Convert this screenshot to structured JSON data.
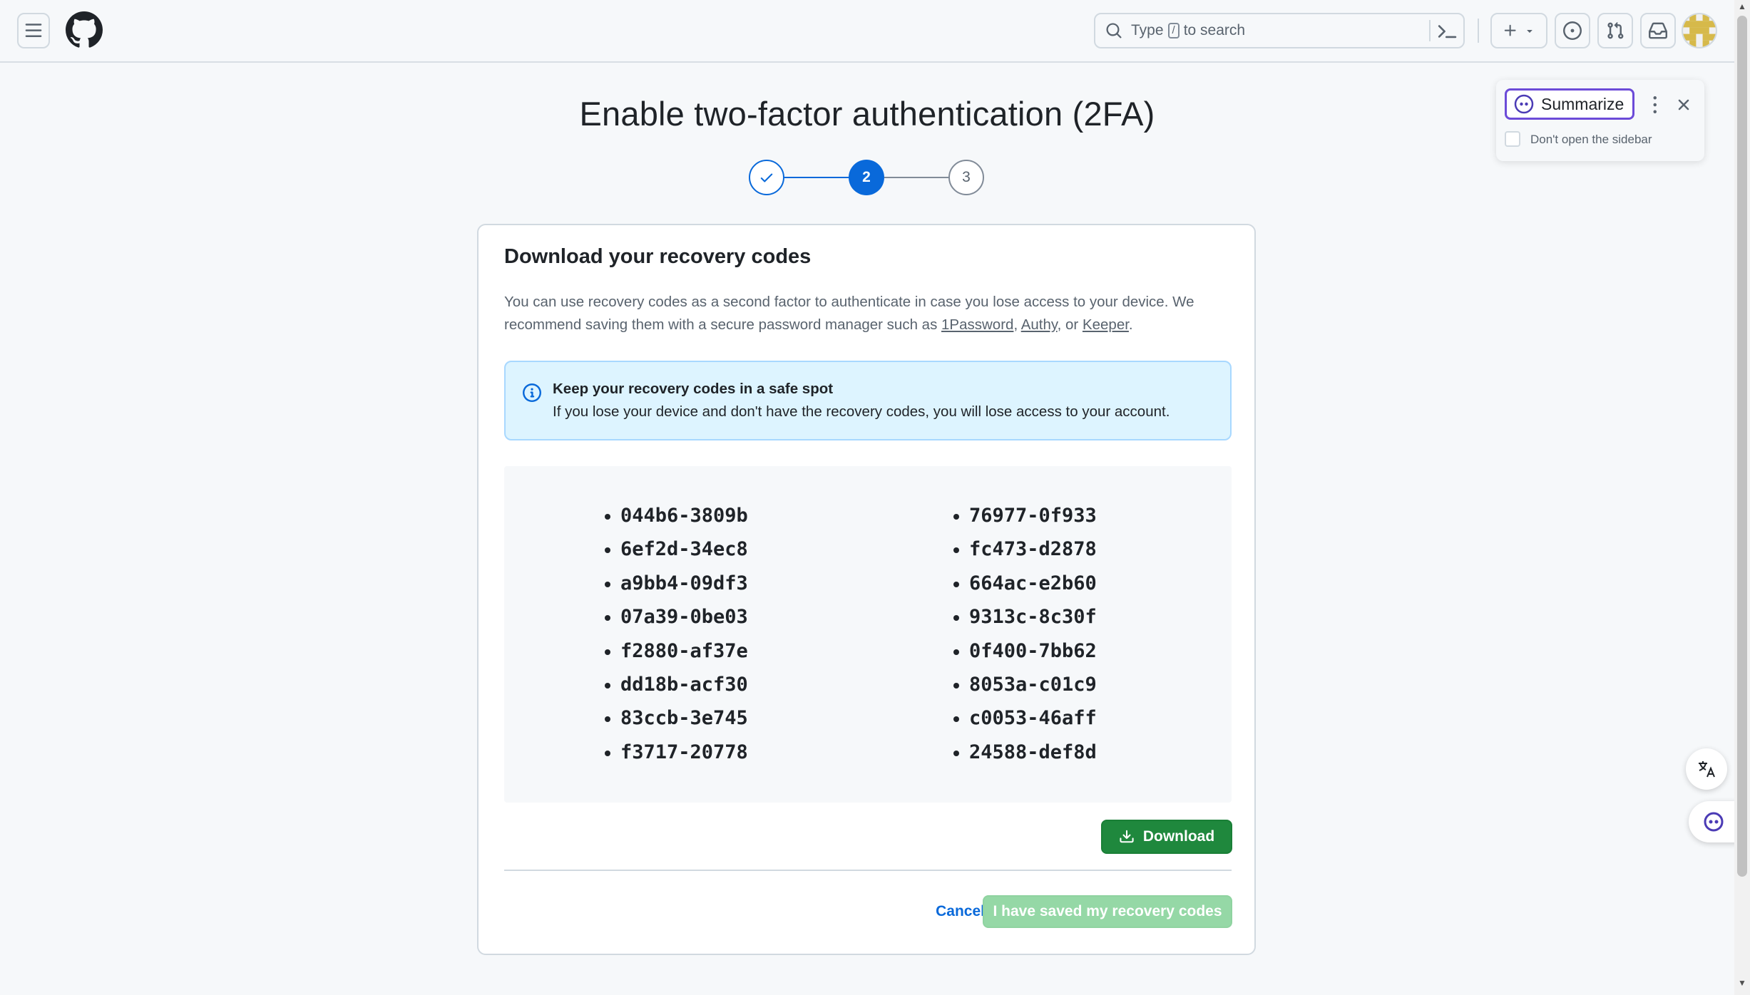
{
  "header": {
    "search_prefix": "Type",
    "search_key": "/",
    "search_suffix": "to search"
  },
  "page": {
    "title": "Enable two-factor authentication (2FA)",
    "steps": [
      "",
      "2",
      "3"
    ]
  },
  "card": {
    "heading": "Download your recovery codes",
    "desc_1": "You can use recovery codes as a second factor to authenticate in case you lose access to your device. We recommend saving them with a secure password manager such as ",
    "link_1password": "1Password",
    "sep_1": ", ",
    "link_authy": "Authy",
    "sep_2": ", or ",
    "link_keeper": "Keeper",
    "desc_end": ".",
    "flash_title": "Keep your recovery codes in a safe spot",
    "flash_body": "If you lose your device and don't have the recovery codes, you will lose access to your account.",
    "codes_left": [
      "044b6-3809b",
      "6ef2d-34ec8",
      "a9bb4-09df3",
      "07a39-0be03",
      "f2880-af37e",
      "dd18b-acf30",
      "83ccb-3e745",
      "f3717-20778"
    ],
    "codes_right": [
      "76977-0f933",
      "fc473-d2878",
      "664ac-e2b60",
      "9313c-8c30f",
      "0f400-7bb62",
      "8053a-c01c9",
      "c0053-46aff",
      "24588-def8d"
    ],
    "download_label": "Download",
    "cancel_label": "Cancel",
    "saved_label": "I have saved my recovery codes"
  },
  "popup": {
    "summarize_label": "Summarize",
    "dont_open_label": "Don't open the sidebar"
  }
}
